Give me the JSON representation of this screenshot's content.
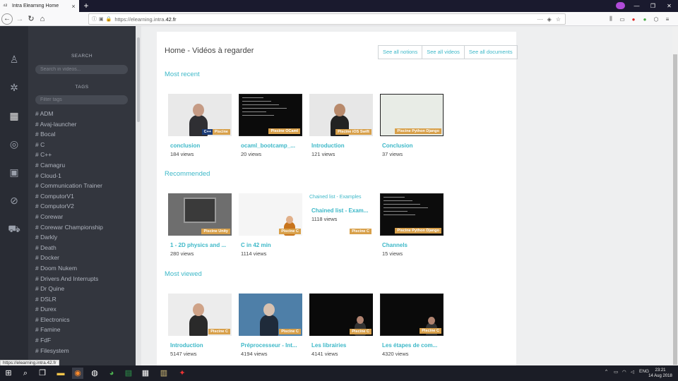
{
  "browser": {
    "tab_title": "Intra Elearning Home",
    "url_prefix": "https://elearning.intra.",
    "url_domain": "42.fr",
    "url_more": "···"
  },
  "sidebar": {
    "search_label": "SEARCH",
    "search_placeholder": "Search in videos...",
    "tags_label": "TAGS",
    "tags_placeholder": "Filter tags",
    "tags": [
      "# ADM",
      "# Avaj-launcher",
      "# Bocal",
      "# C",
      "# C++",
      "# Camagru",
      "# Cloud-1",
      "# Communication Trainer",
      "# ComputorV1",
      "# ComputorV2",
      "# Corewar",
      "# Corewar Championship",
      "# Darkly",
      "# Death",
      "# Docker",
      "# Doom Nukem",
      "# Drivers And Interrupts",
      "# Dr Quine",
      "# DSLR",
      "# Durex",
      "# Electronics",
      "# Famine",
      "# FdF",
      "# Filesystem"
    ]
  },
  "page": {
    "title": "Home - Vidéos à regarder",
    "buttons": [
      "See all notions",
      "See all videos",
      "See all documents"
    ]
  },
  "sections": [
    {
      "title": "Most recent",
      "videos": [
        {
          "title": "conclusion",
          "views": "184 views",
          "badges": [
            "C++",
            "Piscine"
          ]
        },
        {
          "title": "ocaml_bootcamp_...",
          "views": "20 views",
          "badges": [
            "Piscine OCaml"
          ]
        },
        {
          "title": "Introduction",
          "views": "121 views",
          "badges": [
            "Piscine iOS Swift"
          ]
        },
        {
          "title": "Conclusion",
          "views": "37 views",
          "badges": [
            "Piscine Python Django"
          ]
        }
      ]
    },
    {
      "title": "Recommended",
      "videos": [
        {
          "title": "1 - 2D physics and ...",
          "views": "280 views",
          "badges": [
            "Piscine Unity"
          ]
        },
        {
          "title": "C in 42 min",
          "views": "1114 views",
          "badges": [
            "Piscine C"
          ]
        },
        {
          "title": "Chained list - Exam...",
          "views": "1118 views",
          "badges": [
            "Piscine C"
          ],
          "overlay": "Chained list - Examples"
        },
        {
          "title": "Channels",
          "views": "15 views",
          "badges": [
            "Piscine Python Django"
          ]
        }
      ]
    },
    {
      "title": "Most viewed",
      "videos": [
        {
          "title": "Introduction",
          "views": "5147 views",
          "badges": [
            "Piscine C"
          ]
        },
        {
          "title": "Préprocesseur - Int...",
          "views": "4194 views",
          "badges": [
            "Piscine C"
          ]
        },
        {
          "title": "Les librairies",
          "views": "4141 views",
          "badges": [
            "Piscine C"
          ]
        },
        {
          "title": "Les étapes de com...",
          "views": "4320 views",
          "badges": [
            "Piscine C"
          ]
        }
      ]
    }
  ],
  "status_url": "https://elearning.intra.42.fr",
  "taskbar": {
    "lang": "ENG",
    "time": "23:21",
    "date": "14 Aug 2018"
  },
  "colors": {
    "accent": "#3db8c8",
    "badge": "#d8a04a",
    "sidebar": "#33363e",
    "rail": "#292c34"
  }
}
